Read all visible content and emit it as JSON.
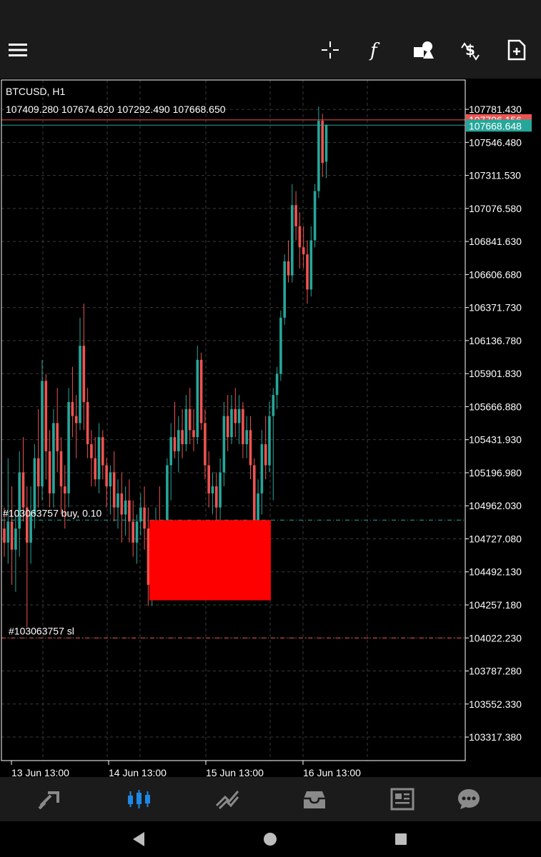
{
  "toolbar": {
    "menu_icon": "menu-icon",
    "icons": [
      "crosshair-icon",
      "indicators-icon",
      "objects-icon",
      "trade-icon",
      "new-order-icon"
    ]
  },
  "chart": {
    "symbol_label": "BTCUSD, H1",
    "ohlc_label": "107409.280 107674.620 107292.490 107668.650",
    "position_label": "#103063757 buy, 0.10",
    "sl_label": "#103063757 sl",
    "ask_label": "107706.156",
    "bid_label": "107668.648",
    "colors": {
      "bull": "#26a69a",
      "bear": "#ef5350",
      "grid": "#3a3a3a",
      "axis": "#ffffff",
      "ask_line": "#ef5350",
      "bid_line": "#26a69a",
      "sl_line": "#ef5350",
      "buy_line": "#26a69a",
      "zone": "#ff0000"
    }
  },
  "chart_data": {
    "type": "candlestick",
    "title": "BTCUSD, H1",
    "y_ticks": [
      107781.43,
      107546.48,
      107311.53,
      107076.58,
      106841.63,
      106606.68,
      106371.73,
      106136.78,
      105901.83,
      105666.88,
      105431.93,
      105196.98,
      104962.03,
      104727.08,
      104492.13,
      104257.18,
      104022.23,
      103787.28,
      103552.33,
      103317.38
    ],
    "y_tick_labels": [
      "107781.430",
      "107546.480",
      "107311.530",
      "107076.580",
      "106841.630",
      "106606.680",
      "106371.730",
      "106136.780",
      "105901.830",
      "105666.880",
      "105431.930",
      "105196.980",
      "104962.030",
      "104727.080",
      "104492.130",
      "104257.180",
      "104022.230",
      "103787.280",
      "103552.330",
      "103317.380"
    ],
    "x_tick_labels": [
      "13 Jun 13:00",
      "14 Jun 13:00",
      "15 Jun 13:00",
      "16 Jun 13:00"
    ],
    "ylim": [
      103150,
      107990
    ],
    "ask": 107706.156,
    "bid": 107668.648,
    "buy_entry": 104860,
    "stop_loss": 104022.23,
    "zone_range": [
      104860,
      104290
    ],
    "ohlc": [
      [
        104800,
        104950,
        104600,
        104700
      ],
      [
        104700,
        105300,
        104550,
        104850
      ],
      [
        104850,
        105100,
        104400,
        104650
      ],
      [
        104650,
        104900,
        104350,
        104800
      ],
      [
        104800,
        105350,
        104600,
        105200
      ],
      [
        105200,
        105450,
        104850,
        104950
      ],
      [
        104950,
        105100,
        104100,
        104700
      ],
      [
        104700,
        105100,
        104550,
        104900
      ],
      [
        104900,
        105400,
        104800,
        105300
      ],
      [
        105300,
        105650,
        104950,
        105100
      ],
      [
        105100,
        106000,
        105000,
        105850
      ],
      [
        105850,
        105900,
        105150,
        105350
      ],
      [
        105350,
        105500,
        104950,
        105050
      ],
      [
        105050,
        105650,
        104950,
        105550
      ],
      [
        105550,
        105800,
        105200,
        105350
      ],
      [
        105350,
        105450,
        104900,
        105100
      ],
      [
        105100,
        105250,
        104800,
        105050
      ],
      [
        105050,
        105800,
        104950,
        105700
      ],
      [
        105700,
        105950,
        105450,
        105600
      ],
      [
        105600,
        105750,
        105300,
        105550
      ],
      [
        105550,
        106300,
        105500,
        106100
      ],
      [
        106100,
        106400,
        105500,
        105700
      ],
      [
        105700,
        105800,
        105300,
        105400
      ],
      [
        105400,
        105500,
        105100,
        105300
      ],
      [
        105300,
        105450,
        105100,
        105150
      ],
      [
        105150,
        105550,
        105050,
        105450
      ],
      [
        105450,
        105500,
        105150,
        105250
      ],
      [
        105250,
        105300,
        104950,
        105100
      ],
      [
        105100,
        105250,
        104900,
        105200
      ],
      [
        105200,
        105350,
        104850,
        104950
      ],
      [
        104950,
        105150,
        104800,
        105050
      ],
      [
        105050,
        105200,
        104700,
        104900
      ],
      [
        104900,
        105100,
        104750,
        105000
      ],
      [
        105000,
        105150,
        104700,
        104850
      ],
      [
        104850,
        105000,
        104600,
        104700
      ],
      [
        104700,
        104900,
        104550,
        104850
      ],
      [
        104850,
        105050,
        104750,
        104950
      ],
      [
        104950,
        105100,
        104650,
        104800
      ],
      [
        104800,
        104950,
        104250,
        104400
      ],
      [
        104400,
        104700,
        104250,
        104600
      ],
      [
        104600,
        104950,
        104550,
        104850
      ],
      [
        104850,
        105100,
        104600,
        104700
      ],
      [
        104700,
        104850,
        104450,
        104800
      ],
      [
        104800,
        105300,
        104700,
        105250
      ],
      [
        105250,
        105550,
        105000,
        105450
      ],
      [
        105450,
        105700,
        105300,
        105350
      ],
      [
        105350,
        105600,
        105200,
        105500
      ],
      [
        105500,
        105650,
        105300,
        105400
      ],
      [
        105400,
        105750,
        105350,
        105650
      ],
      [
        105650,
        105800,
        105400,
        105500
      ],
      [
        105500,
        105650,
        105350,
        105450
      ],
      [
        105450,
        106100,
        105400,
        106000
      ],
      [
        106000,
        106050,
        105500,
        105550
      ],
      [
        105550,
        105650,
        105150,
        105250
      ],
      [
        105250,
        105350,
        104950,
        105050
      ],
      [
        105050,
        105200,
        104900,
        105100
      ],
      [
        105100,
        105200,
        104850,
        104950
      ],
      [
        104950,
        105300,
        104850,
        105200
      ],
      [
        105200,
        105700,
        105100,
        105600
      ],
      [
        105600,
        105750,
        105350,
        105450
      ],
      [
        105450,
        105750,
        105400,
        105650
      ],
      [
        105650,
        105800,
        105450,
        105550
      ],
      [
        105550,
        105750,
        105400,
        105650
      ],
      [
        105650,
        105700,
        105300,
        105400
      ],
      [
        105400,
        105600,
        105300,
        105500
      ],
      [
        105500,
        105600,
        105150,
        105250
      ],
      [
        105250,
        105300,
        104700,
        104800
      ],
      [
        104800,
        105150,
        104550,
        105050
      ],
      [
        105050,
        105500,
        104900,
        105400
      ],
      [
        105400,
        105600,
        105150,
        105250
      ],
      [
        105250,
        105700,
        105200,
        105600
      ],
      [
        105600,
        105800,
        105000,
        105750
      ],
      [
        105750,
        105950,
        105650,
        105900
      ],
      [
        105900,
        106350,
        105850,
        106300
      ],
      [
        106300,
        106750,
        106250,
        106700
      ],
      [
        106700,
        106850,
        106550,
        106600
      ],
      [
        106600,
        107250,
        106550,
        107100
      ],
      [
        107100,
        107200,
        106850,
        106950
      ],
      [
        106950,
        107050,
        106650,
        106800
      ],
      [
        106800,
        106950,
        106650,
        106750
      ],
      [
        106750,
        106850,
        106400,
        106500
      ],
      [
        106500,
        106950,
        106450,
        106850
      ],
      [
        106850,
        107250,
        106800,
        107200
      ],
      [
        107200,
        107800,
        107150,
        107700
      ],
      [
        107700,
        107750,
        107300,
        107400
      ],
      [
        107409.28,
        107674.62,
        107292.49,
        107668.65
      ]
    ]
  },
  "nav": {
    "items": [
      "quotes-icon",
      "chart-icon",
      "trade-icon",
      "history-icon",
      "news-icon",
      "chat-icon"
    ],
    "active_color": "#1e88e5",
    "inactive_color": "#8a8a8a"
  },
  "system": {
    "buttons": [
      "back-icon",
      "home-icon",
      "recents-icon"
    ]
  }
}
